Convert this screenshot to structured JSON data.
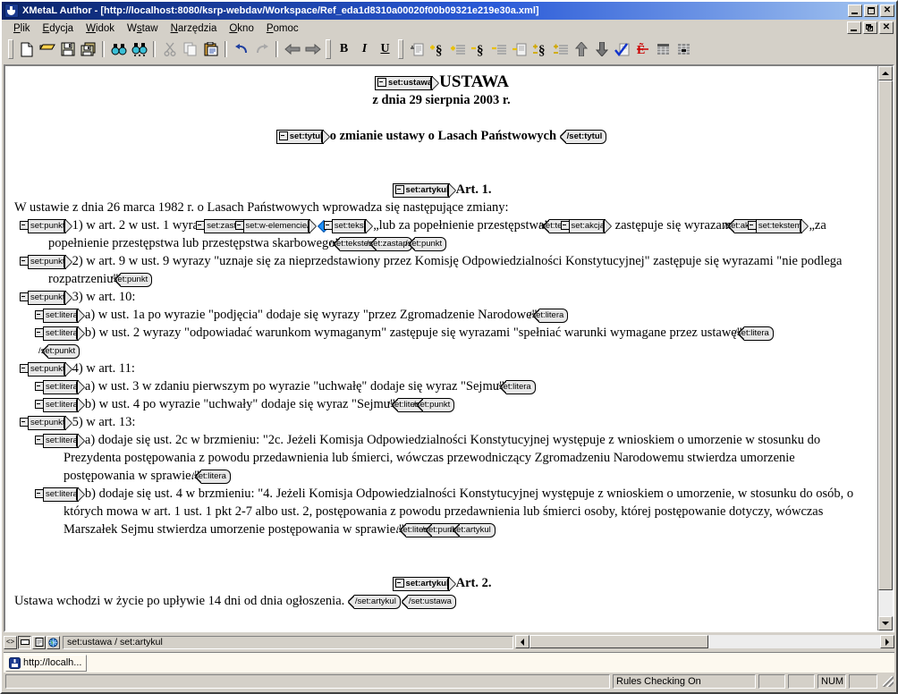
{
  "window": {
    "title": "XMetaL Author - [http://localhost:8080/ksrp-webdav/Workspace/Ref_eda1d8310a00020f00b09321e219e30a.xml]",
    "app_icon": "xmetal-logo-icon",
    "buttons": {
      "minimize": "_",
      "maximize": "□",
      "close": "✕"
    },
    "mdi_buttons": {
      "minimize": "_",
      "restore": "❐",
      "close": "✕"
    }
  },
  "menubar": {
    "items": [
      {
        "label": "Plik",
        "accel": "P"
      },
      {
        "label": "Edycja",
        "accel": "E"
      },
      {
        "label": "Widok",
        "accel": "W"
      },
      {
        "label": "Wstaw",
        "accel": "s"
      },
      {
        "label": "Narzędzia",
        "accel": "N"
      },
      {
        "label": "Okno",
        "accel": "O"
      },
      {
        "label": "Pomoc",
        "accel": "P"
      }
    ]
  },
  "toolbar": {
    "groups": [
      {
        "buttons": [
          {
            "name": "new-document-button",
            "icon": "new-page-icon"
          },
          {
            "name": "open-document-button",
            "icon": "open-folder-icon"
          },
          {
            "name": "save-document-button",
            "icon": "floppy-disk-icon"
          },
          {
            "name": "save-all-button",
            "icon": "multiple-floppy-icon"
          }
        ]
      },
      {
        "buttons": [
          {
            "name": "find-button",
            "icon": "binoculars-icon"
          },
          {
            "name": "find-replace-button",
            "icon": "binoculars-replace-icon"
          }
        ]
      },
      {
        "buttons": [
          {
            "name": "cut-button",
            "icon": "scissors-icon"
          },
          {
            "name": "copy-button",
            "icon": "copy-pages-icon"
          },
          {
            "name": "paste-button",
            "icon": "clipboard-icon"
          }
        ]
      },
      {
        "buttons": [
          {
            "name": "undo-button",
            "icon": "undo-arrow-icon"
          },
          {
            "name": "redo-button",
            "icon": "redo-arrow-icon"
          }
        ]
      },
      {
        "buttons": [
          {
            "name": "back-button",
            "icon": "arrow-left-icon"
          },
          {
            "name": "forward-button",
            "icon": "arrow-right-icon"
          }
        ]
      },
      {
        "buttons": [
          {
            "name": "bold-button",
            "icon": "bold-icon",
            "label": "B"
          },
          {
            "name": "italic-button",
            "icon": "italic-icon",
            "label": "I"
          },
          {
            "name": "underline-button",
            "icon": "underline-icon",
            "label": "U"
          }
        ]
      },
      {
        "buttons": [
          {
            "name": "insert-element-button",
            "icon": "insert-element-icon"
          },
          {
            "name": "add-paragraph-button",
            "icon": "plus-section-icon"
          },
          {
            "name": "add-list-item-button",
            "icon": "plus-lines-icon"
          },
          {
            "name": "remove-paragraph-button",
            "icon": "minus-section-icon"
          },
          {
            "name": "remove-list-item-button",
            "icon": "minus-lines-icon"
          },
          {
            "name": "remove-element-button",
            "icon": "minus-page-icon"
          },
          {
            "name": "change-section-button",
            "icon": "plusminus-section-icon"
          },
          {
            "name": "change-lines-button",
            "icon": "plusminus-lines-icon"
          },
          {
            "name": "move-up-button",
            "icon": "arrow-up-icon"
          },
          {
            "name": "move-down-button",
            "icon": "arrow-down-icon"
          },
          {
            "name": "validate-button",
            "icon": "check-document-icon"
          },
          {
            "name": "spellcheck-button",
            "icon": "red-abc-icon"
          },
          {
            "name": "insert-table-button",
            "icon": "table-icon"
          },
          {
            "name": "table-properties-button",
            "icon": "table-cell-icon"
          }
        ]
      }
    ]
  },
  "document": {
    "blocks": [
      {
        "type": "center",
        "bold": true,
        "size": "big",
        "parts": [
          {
            "t": "tag-start",
            "label": "set:ustawa"
          },
          {
            "t": "text",
            "v": "USTAWA"
          }
        ]
      },
      {
        "type": "center",
        "bold": true,
        "parts": [
          {
            "t": "text",
            "v": "z dnia 29 sierpnia 2003 r."
          }
        ]
      },
      {
        "type": "blank",
        "parts": []
      },
      {
        "type": "center",
        "bold": true,
        "parts": [
          {
            "t": "tag-start",
            "label": "set:tytul"
          },
          {
            "t": "text",
            "v": "o zmianie ustawy o Lasach Państwowych "
          },
          {
            "t": "tag-end",
            "label": "/set:tytul"
          }
        ]
      },
      {
        "type": "blank",
        "parts": []
      },
      {
        "type": "blank",
        "parts": []
      },
      {
        "type": "center",
        "bold": true,
        "parts": [
          {
            "t": "tag-start",
            "label": "set:artykul"
          },
          {
            "t": "text",
            "v": "Art. 1."
          }
        ]
      },
      {
        "type": "para",
        "parts": [
          {
            "t": "text",
            "v": "W ustawie z dnia 26 marca 1982 r. o Lasach Państwowych wprowadza się następujące zmiany:"
          }
        ]
      },
      {
        "type": "para",
        "indent": 1,
        "parts": [
          {
            "t": "tag-start",
            "label": "set:punkt"
          },
          {
            "t": "text",
            "v": "1) w art. 2 w ust. 1 wyrazy "
          },
          {
            "t": "tag-start",
            "label": "set:zastap"
          },
          {
            "t": "tag-start",
            "label": "set:w-elemencie/"
          },
          {
            "t": "diamond"
          },
          {
            "t": "bullet"
          },
          {
            "t": "tag-start",
            "label": "set:tekst"
          },
          {
            "t": "text",
            "v": "„lub za popełnienie przestępstwa” "
          },
          {
            "t": "tag-end",
            "label": "/set:tekst"
          },
          {
            "t": "tag-start",
            "label": "set:akcja"
          },
          {
            "t": "text",
            "v": " zastępuje się wyrazami "
          },
          {
            "t": "tag-end",
            "label": "/set:akcja"
          },
          {
            "t": "tag-start",
            "label": "set:tekstem"
          },
          {
            "t": "text",
            "v": "„za popełnienie przestępstwa lub przestępstwa skarbowego” "
          },
          {
            "t": "tag-end",
            "label": "/set:tekstem"
          },
          {
            "t": "tag-end",
            "label": "/set:zastap"
          },
          {
            "t": "text",
            "v": ", "
          },
          {
            "t": "tag-end",
            "label": "/set:punkt"
          }
        ]
      },
      {
        "type": "para",
        "indent": 1,
        "parts": [
          {
            "t": "tag-start",
            "label": "set:punkt"
          },
          {
            "t": "text",
            "v": "2) w art. 9 w ust. 9 wyrazy \"uznaje się za nieprzedstawiony przez Komisję Odpowiedzialności Konstytucyjnej\" zastępuje się wyrazami \"nie podlega rozpatrzeniu\"; "
          },
          {
            "t": "tag-end",
            "label": "/set:punkt"
          }
        ]
      },
      {
        "type": "para",
        "indent": 1,
        "parts": [
          {
            "t": "tag-start",
            "label": "set:punkt"
          },
          {
            "t": "text",
            "v": "3) w art. 10:"
          }
        ]
      },
      {
        "type": "para",
        "indent": 2,
        "parts": [
          {
            "t": "tag-start",
            "label": "set:litera"
          },
          {
            "t": "text",
            "v": "a) w ust. 1a po wyrazie \"podjęcia\" dodaje się wyrazy \"przez Zgromadzenie Narodowe\", "
          },
          {
            "t": "tag-end",
            "label": "/set:litera"
          }
        ]
      },
      {
        "type": "para",
        "indent": 2,
        "parts": [
          {
            "t": "tag-start",
            "label": "set:litera"
          },
          {
            "t": "text",
            "v": "b) w ust. 2 wyrazy \"odpowiadać warunkom wymaganym\" zastępuje się wyrazami \"spełniać warunki wymagane przez ustawę\"; "
          },
          {
            "t": "tag-end",
            "label": "/set:litera"
          }
        ]
      },
      {
        "type": "para",
        "indent": 2,
        "parts": [
          {
            "t": "tag-end",
            "label": "/set:punkt"
          }
        ]
      },
      {
        "type": "para",
        "indent": 1,
        "parts": [
          {
            "t": "tag-start",
            "label": "set:punkt"
          },
          {
            "t": "text",
            "v": "4) w art. 11:"
          }
        ]
      },
      {
        "type": "para",
        "indent": 2,
        "parts": [
          {
            "t": "tag-start",
            "label": "set:litera"
          },
          {
            "t": "text",
            "v": "a) w ust. 3 w zdaniu pierwszym po wyrazie \"uchwałę\" dodaje się wyraz \"Sejmu\", "
          },
          {
            "t": "tag-end",
            "label": "/set:litera"
          }
        ]
      },
      {
        "type": "para",
        "indent": 2,
        "parts": [
          {
            "t": "tag-start",
            "label": "set:litera"
          },
          {
            "t": "text",
            "v": "b) w ust. 4 po wyrazie \"uchwały\" dodaje się wyraz \"Sejmu\"; "
          },
          {
            "t": "tag-end",
            "label": "/set:litera"
          },
          {
            "t": "tag-end",
            "label": "/set:punkt"
          }
        ]
      },
      {
        "type": "para",
        "indent": 1,
        "parts": [
          {
            "t": "tag-start",
            "label": "set:punkt"
          },
          {
            "t": "text",
            "v": "5) w art. 13:"
          }
        ]
      },
      {
        "type": "para",
        "indent": 2,
        "parts": [
          {
            "t": "tag-start",
            "label": "set:litera"
          },
          {
            "t": "text",
            "v": "a) dodaje się ust. 2c w brzmieniu: \"2c. Jeżeli Komisja Odpowiedzialności Konstytucyjnej występuje z wnioskiem o umorzenie w stosunku do Prezydenta postępowania z powodu przedawnienia lub śmierci, wówczas przewodniczący Zgromadzeniu Narodowemu stwierdza umorzenie postępowania w sprawie.\", "
          },
          {
            "t": "tag-end",
            "label": "/set:litera"
          }
        ]
      },
      {
        "type": "para",
        "indent": 2,
        "parts": [
          {
            "t": "tag-start",
            "label": "set:litera"
          },
          {
            "t": "text",
            "v": "b) dodaje się ust. 4 w brzmieniu: \"4. Jeżeli Komisja Odpowiedzialności Konstytucyjnej występuje z wnioskiem o umorzenie, w stosunku do osób, o których mowa w art. 1 ust. 1 pkt 2-7 albo ust. 2, postępowania z powodu przedawnienia lub śmierci osoby, której postępowanie dotyczy, wówczas Marszałek Sejmu stwierdza umorzenie postępowania w sprawie.\". "
          },
          {
            "t": "tag-end",
            "label": "/set:litera"
          },
          {
            "t": "tag-end",
            "label": "/set:punkt"
          },
          {
            "t": "tag-end",
            "label": "/set:artykul"
          }
        ]
      },
      {
        "type": "blank",
        "parts": []
      },
      {
        "type": "blank",
        "parts": []
      },
      {
        "type": "center",
        "bold": true,
        "parts": [
          {
            "t": "tag-start",
            "label": "set:artykul"
          },
          {
            "t": "text",
            "v": "Art. 2."
          }
        ]
      },
      {
        "type": "para",
        "parts": [
          {
            "t": "text",
            "v": "Ustawa wchodzi w życie po upływie 14 dni od dnia ogłoszenia. "
          },
          {
            "t": "tag-end",
            "label": "/set:artykul"
          },
          {
            "t": "tag-end",
            "label": "/set:ustawa"
          }
        ]
      }
    ]
  },
  "element_bar": {
    "view_buttons": [
      {
        "name": "tags-on-view-button",
        "glyph": "<>"
      },
      {
        "name": "normal-view-button",
        "glyph": "▭"
      },
      {
        "name": "plain-text-view-button",
        "glyph": "☰"
      },
      {
        "name": "browser-preview-button",
        "glyph": "globe-icon"
      }
    ],
    "path": "set:ustawa / set:artykul"
  },
  "mdi_taskbar": {
    "tabs": [
      {
        "label": "http://localh...",
        "icon": "xmetal-doc-icon"
      }
    ]
  },
  "statusbar": {
    "message": "",
    "rules": "Rules Checking On",
    "pane3": "",
    "pane4": "",
    "num": "NUM",
    "pane6": ""
  },
  "colors": {
    "face": "#d4d0c8",
    "title_start": "#0a246a",
    "title_end": "#a6c7f0",
    "tag_fill": "#e8e8e8",
    "diamond": "#1e90ff",
    "page": "#ffffff"
  }
}
